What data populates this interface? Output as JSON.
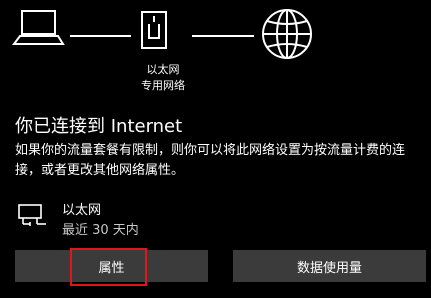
{
  "network_diagram": {
    "adapter_name": "以太网",
    "network_type": "专用网络"
  },
  "status": {
    "title": "你已连接到 Internet",
    "description": "如果你的流量套餐有限制，则你可以将此网络设置为按流量计费的连接，或者更改其他网络属性。"
  },
  "connection": {
    "name": "以太网",
    "usage": "最近 30 天内"
  },
  "buttons": {
    "properties": "属性",
    "data_usage": "数据使用量"
  },
  "colors": {
    "background": "#000000",
    "button_bg": "#3b3b3b",
    "highlight": "#e0161b"
  }
}
